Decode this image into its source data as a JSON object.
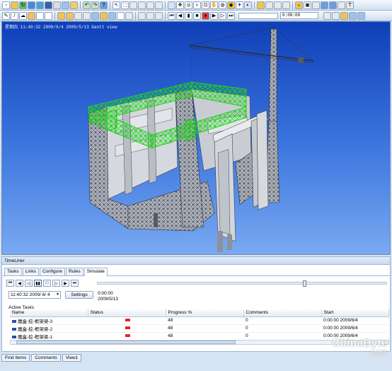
{
  "toolbar": {
    "time_display": "0:00:00"
  },
  "viewport": {
    "header_text": "星期四 11:40:32 2009/6/4 2009/5/13 Gantt view"
  },
  "timeliner": {
    "title": "TimeLiner",
    "tabs": [
      "Tasks",
      "Links",
      "Configure",
      "Rules",
      "Simulate"
    ],
    "active_tab": "Simulate",
    "date_value": "11:40:32 2009/ 6/ 4",
    "settings_label": "Settings",
    "sim_time": "0:00:00",
    "sim_date": "2009/5/13",
    "slider_position": 0.72,
    "active_tasks_label": "Active Tasks",
    "columns": [
      "Name",
      "Status",
      "Progress %",
      "Comments",
      "Start"
    ],
    "rows": [
      {
        "name": "魔盒-挖-框架梁-3",
        "progress": "48",
        "comments": "0",
        "start": "0:00:00 2009/6/4"
      },
      {
        "name": "魔盒-挖-框架梁-2",
        "progress": "48",
        "comments": "0",
        "start": "0:00:00 2009/6/4"
      },
      {
        "name": "魔盒-挖-框架梁-1",
        "progress": "48",
        "comments": "0",
        "start": "0:00:00 2009/6/4"
      }
    ]
  },
  "bottom_tabs": [
    "Find Items",
    "Comments",
    "View1"
  ],
  "watermark": {
    "line1": "ChinaByte",
    "line2": "比特网"
  },
  "colors": {
    "sky_top": "#0f3fb8",
    "sky_bottom": "#6aa0f0",
    "highlight_green": "#22d11f",
    "status_red": "#d92b2b"
  }
}
